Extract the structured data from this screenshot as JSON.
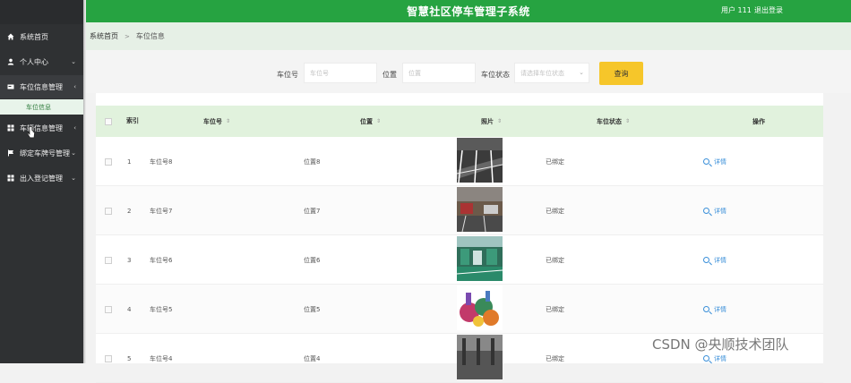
{
  "header": {
    "title": "智慧社区停车管理子系统",
    "user": "用户 111",
    "logout": "退出登录"
  },
  "sidebar": {
    "items": [
      {
        "label": "系统首页",
        "icon": "home-icon"
      },
      {
        "label": "个人中心",
        "icon": "user-icon"
      },
      {
        "label": "车位信息管理",
        "icon": "card-icon"
      },
      {
        "label": "车辆信息管理",
        "icon": "grid-icon"
      },
      {
        "label": "绑定车牌号管理",
        "icon": "flag-icon"
      },
      {
        "label": "出入登记管理",
        "icon": "grid-icon"
      }
    ],
    "submenu": {
      "label": "车位信息"
    }
  },
  "breadcrumb": {
    "home": "系统首页",
    "separator": ">",
    "current": "车位信息"
  },
  "search": {
    "slot_label": "车位号",
    "slot_placeholder": "车位号",
    "location_label": "位置",
    "location_placeholder": "位置",
    "status_label": "车位状态",
    "status_placeholder": "请选择车位状态",
    "query_button": "查询"
  },
  "table": {
    "headers": {
      "index": "索引",
      "slot": "车位号",
      "location": "位置",
      "photo": "照片",
      "status": "车位状态",
      "action": "操作"
    },
    "rows": [
      {
        "index": "1",
        "slot": "车位号8",
        "location": "位置8",
        "status": "已绑定",
        "action": "详情"
      },
      {
        "index": "2",
        "slot": "车位号7",
        "location": "位置7",
        "status": "已绑定",
        "action": "详情"
      },
      {
        "index": "3",
        "slot": "车位号6",
        "location": "位置6",
        "status": "已绑定",
        "action": "详情"
      },
      {
        "index": "4",
        "slot": "车位号5",
        "location": "位置5",
        "status": "已绑定",
        "action": "详情"
      },
      {
        "index": "5",
        "slot": "车位号4",
        "location": "位置4",
        "status": "已绑定",
        "action": "详情"
      }
    ]
  },
  "watermark": "CSDN @央顺技术团队",
  "colors": {
    "header_green": "#26a341",
    "sidebar_dark": "#2f3133",
    "table_header_bg": "#e1f2dd",
    "query_button": "#f6c62a",
    "link_blue": "#3a8fd9"
  }
}
